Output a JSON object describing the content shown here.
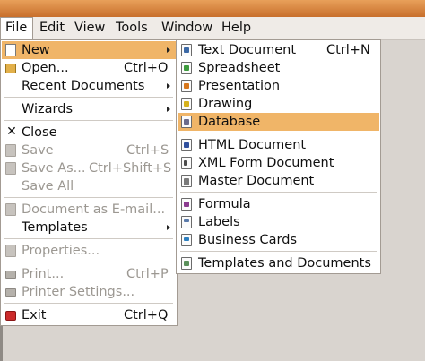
{
  "menubar": {
    "items": [
      {
        "label": "File",
        "mnemonic": "F"
      },
      {
        "label": "Edit",
        "mnemonic": "E"
      },
      {
        "label": "View",
        "mnemonic": "V"
      },
      {
        "label": "Tools",
        "mnemonic": "T"
      },
      {
        "label": "Window",
        "mnemonic": "W"
      },
      {
        "label": "Help",
        "mnemonic": "H"
      }
    ]
  },
  "file_menu": {
    "new": "New",
    "open": "Open...",
    "open_shortcut": "Ctrl+O",
    "recent": "Recent Documents",
    "wizards": "Wizards",
    "close": "Close",
    "save": "Save",
    "save_shortcut": "Ctrl+S",
    "save_as": "Save As...",
    "save_as_shortcut": "Ctrl+Shift+S",
    "save_all": "Save All",
    "email": "Document as E-mail...",
    "templates": "Templates",
    "properties": "Properties...",
    "print": "Print...",
    "print_shortcut": "Ctrl+P",
    "printer_settings": "Printer Settings...",
    "exit": "Exit",
    "exit_shortcut": "Ctrl+Q"
  },
  "new_submenu": {
    "text_document": "Text Document",
    "text_document_shortcut": "Ctrl+N",
    "spreadsheet": "Spreadsheet",
    "presentation": "Presentation",
    "drawing": "Drawing",
    "database": "Database",
    "html_document": "HTML Document",
    "xml_form_document": "XML Form Document",
    "master_document": "Master Document",
    "formula": "Formula",
    "labels": "Labels",
    "business_cards": "Business Cards",
    "templates_and_documents": "Templates and Documents"
  },
  "highlight_color": "#f0b568",
  "titlebar_color": "#d8863e"
}
